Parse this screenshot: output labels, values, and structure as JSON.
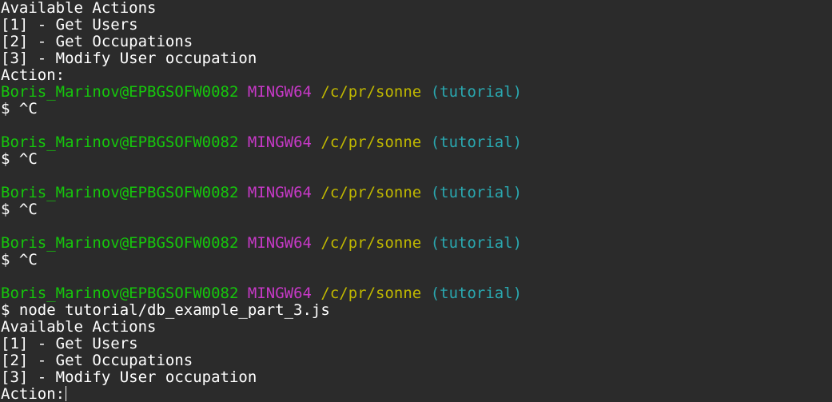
{
  "terminal": {
    "lines": [
      {
        "type": "out",
        "text": "Available Actions"
      },
      {
        "type": "out",
        "text": "[1] - Get Users"
      },
      {
        "type": "out",
        "text": "[2] - Get Occupations"
      },
      {
        "type": "out",
        "text": "[3] - Modify User occupation"
      },
      {
        "type": "out",
        "text": "Action:"
      },
      {
        "type": "prompt",
        "user": "Boris_Marinov@EPBGSOFW0082",
        "system": "MINGW64",
        "path": "/c/pr/sonne",
        "branch": "(tutorial)"
      },
      {
        "type": "out",
        "text": "$ ^C"
      },
      {
        "type": "out",
        "text": ""
      },
      {
        "type": "prompt",
        "user": "Boris_Marinov@EPBGSOFW0082",
        "system": "MINGW64",
        "path": "/c/pr/sonne",
        "branch": "(tutorial)"
      },
      {
        "type": "out",
        "text": "$ ^C"
      },
      {
        "type": "out",
        "text": ""
      },
      {
        "type": "prompt",
        "user": "Boris_Marinov@EPBGSOFW0082",
        "system": "MINGW64",
        "path": "/c/pr/sonne",
        "branch": "(tutorial)"
      },
      {
        "type": "out",
        "text": "$ ^C"
      },
      {
        "type": "out",
        "text": ""
      },
      {
        "type": "prompt",
        "user": "Boris_Marinov@EPBGSOFW0082",
        "system": "MINGW64",
        "path": "/c/pr/sonne",
        "branch": "(tutorial)"
      },
      {
        "type": "out",
        "text": "$ ^C"
      },
      {
        "type": "out",
        "text": ""
      },
      {
        "type": "prompt",
        "user": "Boris_Marinov@EPBGSOFW0082",
        "system": "MINGW64",
        "path": "/c/pr/sonne",
        "branch": "(tutorial)"
      },
      {
        "type": "out",
        "text": "$ node tutorial/db_example_part_3.js"
      },
      {
        "type": "out",
        "text": "Available Actions"
      },
      {
        "type": "out",
        "text": "[1] - Get Users"
      },
      {
        "type": "out",
        "text": "[2] - Get Occupations"
      },
      {
        "type": "out",
        "text": "[3] - Modify User occupation"
      },
      {
        "type": "input",
        "text": "Action:"
      }
    ]
  },
  "colors": {
    "background": "#2b2b2b",
    "text": "#ffffff",
    "user": "#16c60c",
    "system": "#c639c6",
    "path": "#c0b800",
    "branch": "#2aa8b0"
  }
}
